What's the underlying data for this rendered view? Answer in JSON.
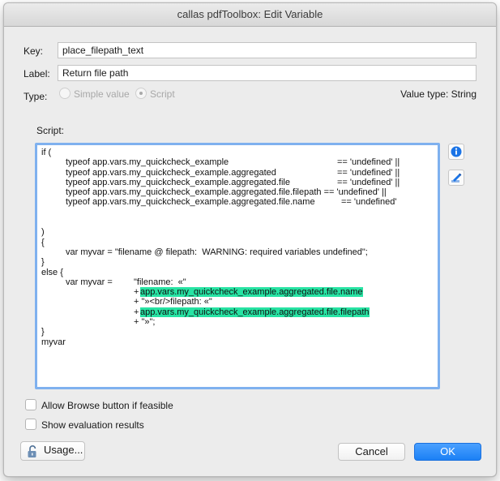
{
  "window": {
    "title": "callas pdfToolbox: Edit Variable"
  },
  "key": {
    "label": "Key:",
    "value": "place_filepath_text"
  },
  "label_field": {
    "label": "Label:",
    "value": "Return file path"
  },
  "type": {
    "label": "Type:",
    "options": [
      {
        "label": "Simple value",
        "selected": false
      },
      {
        "label": "Script",
        "selected": true
      }
    ],
    "value_type": "Value type: String"
  },
  "script": {
    "label": "Script:",
    "lines": [
      {
        "segs": [
          {
            "t": "if ("
          }
        ]
      },
      {
        "segs": [
          {
            "t": "typeof app.vars.my_quickcheck_example"
          },
          {
            "t": "== 'undefined' ||"
          }
        ]
      },
      {
        "segs": [
          {
            "t": "typeof app.vars.my_quickcheck_example.aggregated"
          },
          {
            "t": "== 'undefined' ||"
          }
        ]
      },
      {
        "segs": [
          {
            "t": "typeof app.vars.my_quickcheck_example.aggregated.file"
          },
          {
            "t": "== 'undefined' ||"
          }
        ]
      },
      {
        "segs": [
          {
            "t": "typeof app.vars.my_quickcheck_example.aggregated.file.filepath == 'undefined' ||"
          }
        ]
      },
      {
        "segs": [
          {
            "t": "typeof app.vars.my_quickcheck_example.aggregated.file.name"
          },
          {
            "t": "== 'undefined'"
          }
        ]
      },
      {
        "segs": []
      },
      {
        "segs": []
      },
      {
        "segs": [
          {
            "t": ")"
          }
        ]
      },
      {
        "segs": [
          {
            "t": "{"
          }
        ]
      },
      {
        "segs": [
          {
            "t": "var myvar = \"filename @ filepath:  WARNING: required variables undefined\";"
          }
        ]
      },
      {
        "segs": [
          {
            "t": "}"
          }
        ]
      },
      {
        "segs": [
          {
            "t": "else {"
          }
        ]
      },
      {
        "segs": [
          {
            "t": "var myvar ="
          },
          {
            "t": "\"filename:  «\""
          }
        ]
      },
      {
        "segs": [
          {
            "t": "+ "
          },
          {
            "t": "app.vars.my_quickcheck_example.aggregated.file.name",
            "hl": true
          }
        ]
      },
      {
        "segs": [
          {
            "t": "+ \"»<br/>filepath: «\""
          }
        ]
      },
      {
        "segs": [
          {
            "t": "+ "
          },
          {
            "t": "app.vars.my_quickcheck_example.aggregated.file.filepath",
            "hl": true
          }
        ]
      },
      {
        "segs": [
          {
            "t": "+ \"»\";"
          }
        ]
      },
      {
        "segs": [
          {
            "t": "}"
          }
        ]
      },
      {
        "segs": [
          {
            "t": "myvar"
          }
        ]
      }
    ]
  },
  "allow_browse": {
    "label": "Allow Browse button if feasible",
    "checked": false
  },
  "show_eval": {
    "label": "Show evaluation results",
    "checked": false
  },
  "buttons": {
    "usage": "Usage...",
    "cancel": "Cancel",
    "ok": "OK"
  },
  "colors": {
    "highlight": "#27e3a3",
    "accent": "#1b80f5",
    "focus_ring": "#7fb1ef"
  }
}
